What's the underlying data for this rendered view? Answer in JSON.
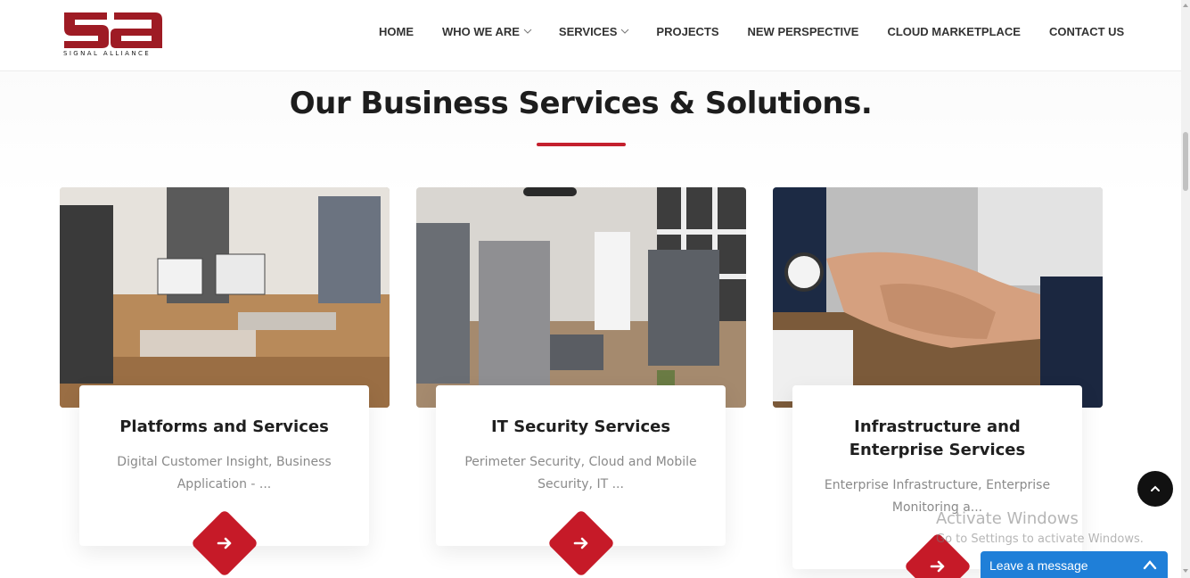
{
  "header": {
    "logo_text": "SIGNAL ALLIANCE",
    "nav": [
      {
        "label": "HOME",
        "has_dropdown": false
      },
      {
        "label": "WHO WE ARE",
        "has_dropdown": true
      },
      {
        "label": "SERVICES",
        "has_dropdown": true
      },
      {
        "label": "PROJECTS",
        "has_dropdown": false
      },
      {
        "label": "NEW PERSPECTIVE",
        "has_dropdown": false
      },
      {
        "label": "CLOUD MARKETPLACE",
        "has_dropdown": false
      },
      {
        "label": "CONTACT US",
        "has_dropdown": false
      }
    ]
  },
  "section": {
    "title": "Our Business Services & Solutions."
  },
  "cards": [
    {
      "title": "Platforms and Services",
      "desc": "Digital Customer Insight, Business Application - ..."
    },
    {
      "title": "IT Security Services",
      "desc": "Perimeter Security, Cloud and Mobile Security, IT ..."
    },
    {
      "title": "Infrastructure and Enterprise Services",
      "desc": "Enterprise Infrastructure, Enterprise Monitoring a..."
    }
  ],
  "watermark": {
    "line1": "Activate Windows",
    "line2": "Go to Settings to activate Windows."
  },
  "chat": {
    "label": "Leave a message"
  },
  "colors": {
    "brand_red": "#c61a28",
    "logo_red": "#9e1b24",
    "chat_blue": "#1f7fd8"
  }
}
